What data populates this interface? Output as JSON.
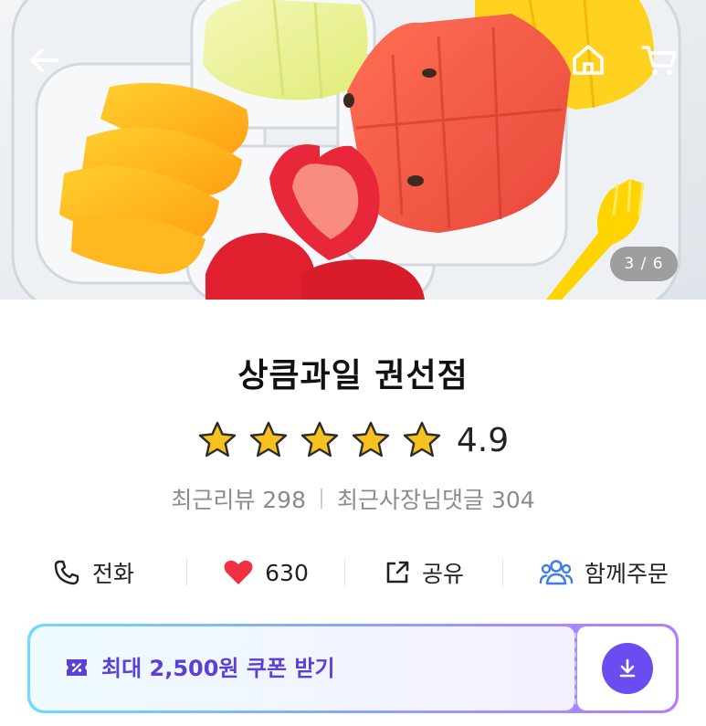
{
  "hero": {
    "page_counter": "3 / 6",
    "icons": [
      "back-arrow-icon",
      "home-icon",
      "cart-icon"
    ]
  },
  "store": {
    "name": "상큼과일 권선점",
    "rating": "4.9",
    "stars": 5,
    "recent_reviews": "최근리뷰 298",
    "owner_replies": "최근사장님댓글 304"
  },
  "actions": {
    "call_label": "전화",
    "like_count": "630",
    "share_label": "공유",
    "group_order_label": "함께주문"
  },
  "coupon": {
    "label": "최대 2,500원 쿠폰 받기"
  },
  "colors": {
    "star_fill": "#f7c21d",
    "heart": "#f03040",
    "group_icon": "#3f7ee8",
    "coupon_text": "#5b3fd6",
    "download_button": "#6a4cf0"
  }
}
